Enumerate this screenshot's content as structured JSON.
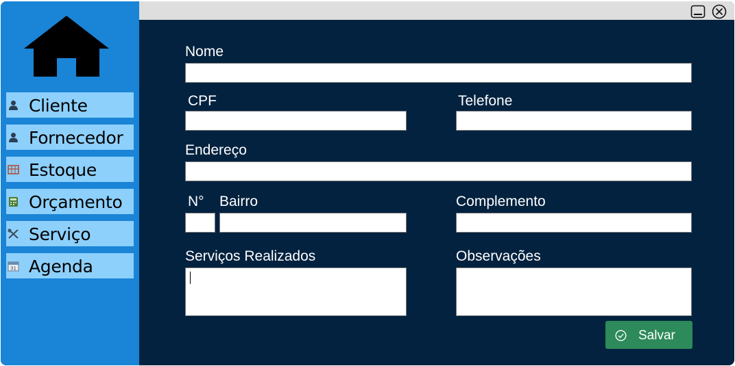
{
  "sidebar": {
    "home_icon": "home-icon",
    "items": [
      {
        "label": "Cliente",
        "icon": "person-icon"
      },
      {
        "label": "Fornecedor",
        "icon": "person-icon"
      },
      {
        "label": "Estoque",
        "icon": "shelf-icon"
      },
      {
        "label": "Orçamento",
        "icon": "calculator-icon"
      },
      {
        "label": "Serviço",
        "icon": "tools-icon"
      },
      {
        "label": "Agenda",
        "icon": "calendar-icon"
      }
    ]
  },
  "titlebar": {
    "minimize_icon": "minimize-icon",
    "close_icon": "close-icon"
  },
  "form": {
    "nome_label": "Nome",
    "nome_value": "",
    "cpf_label": "CPF",
    "cpf_value": "",
    "telefone_label": "Telefone",
    "telefone_value": "",
    "endereco_label": "Endereço",
    "endereco_value": "",
    "numero_label": "N°",
    "numero_value": "",
    "bairro_label": "Bairro",
    "bairro_value": "",
    "complemento_label": "Complemento",
    "complemento_value": "",
    "servicos_label": "Serviços Realizados",
    "servicos_value": "",
    "observacoes_label": "Observações",
    "observacoes_value": "",
    "save_label": "Salvar",
    "save_icon": "check-circle-icon"
  },
  "colors": {
    "sidebar_bg": "#1a84d6",
    "nav_item_bg": "#8dd0fb",
    "main_bg": "#02223f",
    "titlebar_bg": "#dedede",
    "save_button_bg": "#2d8a5a"
  }
}
